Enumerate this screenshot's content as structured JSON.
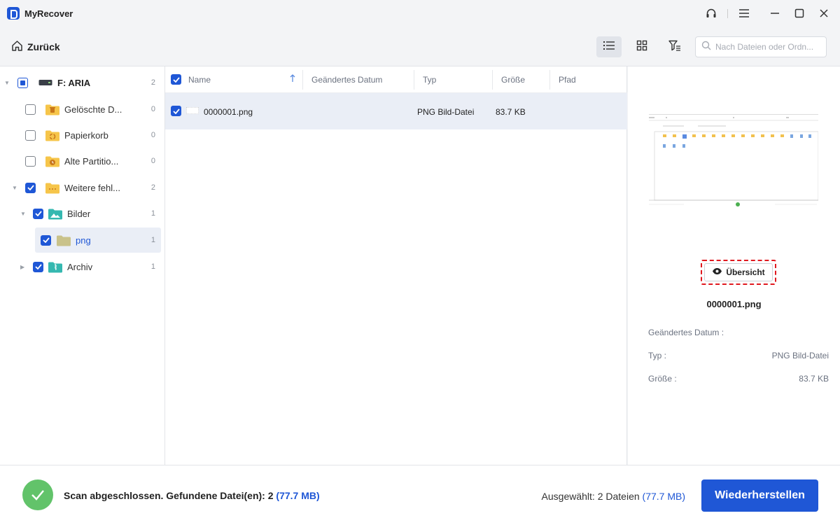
{
  "app": {
    "title": "MyRecover"
  },
  "toolbar": {
    "back_label": "Zurück",
    "search_placeholder": "Nach Dateien oder Ordn..."
  },
  "tree": {
    "root": {
      "label": "F: ARIA",
      "count": "2"
    },
    "items": [
      {
        "label": "Gelöschte D...",
        "count": "0"
      },
      {
        "label": "Papierkorb",
        "count": "0"
      },
      {
        "label": "Alte Partitio...",
        "count": "0"
      },
      {
        "label": "Weitere fehl...",
        "count": "2"
      },
      {
        "label": "Bilder",
        "count": "1"
      },
      {
        "label": "png",
        "count": "1"
      },
      {
        "label": "Archiv",
        "count": "1"
      }
    ]
  },
  "list": {
    "columns": {
      "name": "Name",
      "date": "Geändertes Datum",
      "type": "Typ",
      "size": "Größe",
      "path": "Pfad"
    },
    "rows": [
      {
        "name": "0000001.png",
        "date": "",
        "type": "PNG Bild-Datei",
        "size": "83.7 KB",
        "path": ""
      }
    ]
  },
  "preview": {
    "overview_label": "Übersicht",
    "file_name": "0000001.png",
    "date_label": "Geändertes Datum :",
    "date_value": "",
    "type_label": "Typ :",
    "type_value": "PNG Bild-Datei",
    "size_label": "Größe :",
    "size_value": "83.7 KB"
  },
  "footer": {
    "status_prefix": "Scan abgeschlossen. Gefundene Datei(en): 2",
    "status_size": "(77.7 MB)",
    "selected_prefix": "Ausgewählt: 2 Dateien",
    "selected_size": "(77.7 MB)",
    "restore_label": "Wiederherstellen"
  },
  "colors": {
    "accent": "#1f57d6",
    "success": "#62c36a",
    "highlight": "#e0181f"
  },
  "icons": [
    "app-logo-icon",
    "headset-icon",
    "menu-icon",
    "minimize-icon",
    "maximize-icon",
    "close-icon",
    "home-icon",
    "list-view-icon",
    "grid-view-icon",
    "filter-icon",
    "search-icon",
    "drive-icon",
    "folder-icon",
    "eye-icon",
    "check-icon"
  ]
}
